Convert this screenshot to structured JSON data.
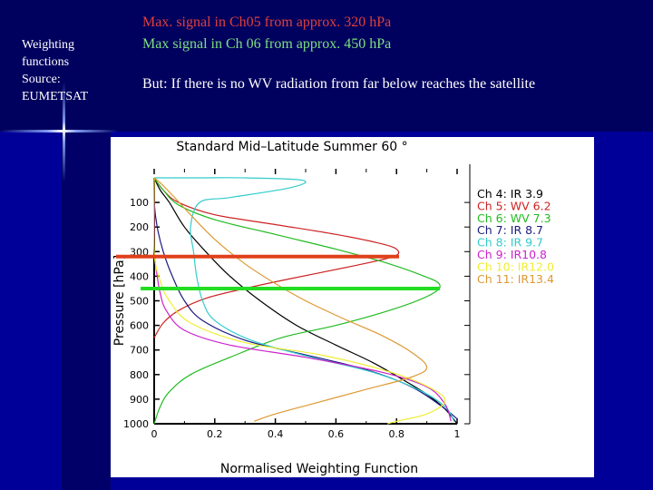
{
  "side_label": [
    "Weighting",
    "functions",
    "Source:",
    "EUMETSAT"
  ],
  "headlines": {
    "line1": "Max. signal in Ch05 from approx. 320 hPa",
    "line2": "Max signal in Ch 06 from approx. 450 hPa",
    "line3": "But: If there is no WV radiation from far below reaches the satellite"
  },
  "colors": {
    "line1": "#e0403a",
    "line2": "#7fe07f",
    "marker_ch5": "#e0401a",
    "marker_ch6": "#22dd22"
  },
  "chart_data": {
    "type": "line",
    "title": "Standard Mid–Latitude Summer 60 °",
    "xlabel": "Normalised Weighting Function",
    "ylabel": "Pressure [hPa]",
    "xlim": [
      0,
      1
    ],
    "ylim": [
      1000,
      0
    ],
    "y_inverted": true,
    "xticks": [
      "0",
      "0.2",
      "0.4",
      "0.6",
      "0.8",
      "1"
    ],
    "xtick_values": [
      0,
      0.2,
      0.4,
      0.6,
      0.8,
      1
    ],
    "yticks": [
      "100",
      "200",
      "300",
      "400",
      "500",
      "600",
      "700",
      "800",
      "900",
      "1000"
    ],
    "ytick_values": [
      100,
      200,
      300,
      400,
      500,
      600,
      700,
      800,
      900,
      1000
    ],
    "grid": false,
    "legend_position": "right",
    "series": [
      {
        "name": "Ch   4: IR  3.9",
        "color": "#000000",
        "points": [
          [
            0.0,
            0
          ],
          [
            0.02,
            50
          ],
          [
            0.05,
            100
          ],
          [
            0.1,
            200
          ],
          [
            0.17,
            300
          ],
          [
            0.25,
            400
          ],
          [
            0.35,
            500
          ],
          [
            0.47,
            600
          ],
          [
            0.6,
            680
          ],
          [
            0.72,
            750
          ],
          [
            0.82,
            820
          ],
          [
            0.9,
            880
          ],
          [
            0.96,
            940
          ],
          [
            1.0,
            1000
          ]
        ]
      },
      {
        "name": "Ch   5: WV  6.2",
        "color": "#cc2222",
        "points": [
          [
            0.0,
            0
          ],
          [
            0.03,
            50
          ],
          [
            0.08,
            100
          ],
          [
            0.2,
            150
          ],
          [
            0.4,
            190
          ],
          [
            0.6,
            230
          ],
          [
            0.74,
            265
          ],
          [
            0.8,
            290
          ],
          [
            0.79,
            320
          ],
          [
            0.65,
            360
          ],
          [
            0.45,
            410
          ],
          [
            0.3,
            450
          ],
          [
            0.17,
            490
          ],
          [
            0.08,
            540
          ],
          [
            0.03,
            590
          ],
          [
            0.0,
            650
          ]
        ]
      },
      {
        "name": "Ch   6: WV  7.3",
        "color": "#22bb22",
        "points": [
          [
            0.0,
            0
          ],
          [
            0.03,
            50
          ],
          [
            0.08,
            110
          ],
          [
            0.2,
            170
          ],
          [
            0.4,
            230
          ],
          [
            0.6,
            290
          ],
          [
            0.75,
            340
          ],
          [
            0.87,
            390
          ],
          [
            0.94,
            430
          ],
          [
            0.92,
            470
          ],
          [
            0.8,
            530
          ],
          [
            0.6,
            600
          ],
          [
            0.42,
            650
          ],
          [
            0.25,
            730
          ],
          [
            0.12,
            800
          ],
          [
            0.05,
            870
          ],
          [
            0.02,
            930
          ],
          [
            0.0,
            1000
          ]
        ]
      },
      {
        "name": "Ch   7: IR  8.7",
        "color": "#1a1a80",
        "points": [
          [
            0.0,
            0
          ],
          [
            0.0,
            100
          ],
          [
            0.01,
            200
          ],
          [
            0.03,
            300
          ],
          [
            0.06,
            400
          ],
          [
            0.1,
            500
          ],
          [
            0.16,
            580
          ],
          [
            0.3,
            660
          ],
          [
            0.5,
            720
          ],
          [
            0.7,
            780
          ],
          [
            0.85,
            850
          ],
          [
            0.95,
            930
          ],
          [
            1.0,
            980
          ]
        ]
      },
      {
        "name": "Ch   8: IR  9.7",
        "color": "#33cccc",
        "points": [
          [
            0.0,
            0
          ],
          [
            0.15,
            0
          ],
          [
            0.3,
            0
          ],
          [
            0.49,
            10
          ],
          [
            0.45,
            40
          ],
          [
            0.25,
            80
          ],
          [
            0.15,
            100
          ],
          [
            0.12,
            200
          ],
          [
            0.13,
            300
          ],
          [
            0.14,
            400
          ],
          [
            0.16,
            500
          ],
          [
            0.2,
            580
          ],
          [
            0.32,
            660
          ],
          [
            0.52,
            730
          ],
          [
            0.72,
            790
          ],
          [
            0.87,
            860
          ],
          [
            0.96,
            930
          ],
          [
            0.99,
            990
          ]
        ]
      },
      {
        "name": "Ch   9: IR10.8",
        "color": "#cc22cc",
        "points": [
          [
            0.0,
            0
          ],
          [
            0.0,
            200
          ],
          [
            0.0,
            300
          ],
          [
            0.01,
            400
          ],
          [
            0.02,
            470
          ],
          [
            0.04,
            540
          ],
          [
            0.1,
            620
          ],
          [
            0.25,
            680
          ],
          [
            0.5,
            730
          ],
          [
            0.75,
            790
          ],
          [
            0.9,
            850
          ],
          [
            0.96,
            920
          ],
          [
            0.98,
            990
          ]
        ]
      },
      {
        "name": "Ch  10: IR12.0",
        "color": "#eeee33",
        "points": [
          [
            0.0,
            0
          ],
          [
            0.0,
            300
          ],
          [
            0.02,
            420
          ],
          [
            0.05,
            500
          ],
          [
            0.12,
            590
          ],
          [
            0.3,
            670
          ],
          [
            0.55,
            720
          ],
          [
            0.78,
            790
          ],
          [
            0.92,
            860
          ],
          [
            0.96,
            910
          ],
          [
            0.9,
            960
          ],
          [
            0.8,
            990
          ],
          [
            0.77,
            1000
          ]
        ]
      },
      {
        "name": "Ch  11: IR13.4",
        "color": "#dd9933",
        "points": [
          [
            0.0,
            0
          ],
          [
            0.02,
            20
          ],
          [
            0.06,
            70
          ],
          [
            0.12,
            150
          ],
          [
            0.2,
            250
          ],
          [
            0.3,
            350
          ],
          [
            0.4,
            430
          ],
          [
            0.5,
            500
          ],
          [
            0.62,
            570
          ],
          [
            0.75,
            640
          ],
          [
            0.85,
            710
          ],
          [
            0.9,
            770
          ],
          [
            0.85,
            810
          ],
          [
            0.7,
            860
          ],
          [
            0.52,
            920
          ],
          [
            0.4,
            960
          ],
          [
            0.33,
            990
          ]
        ]
      }
    ],
    "markers": [
      {
        "label": "Ch05 max",
        "pressure": 320,
        "color": "#e0401a"
      },
      {
        "label": "Ch06 max",
        "pressure": 450,
        "color": "#22dd22"
      }
    ]
  }
}
